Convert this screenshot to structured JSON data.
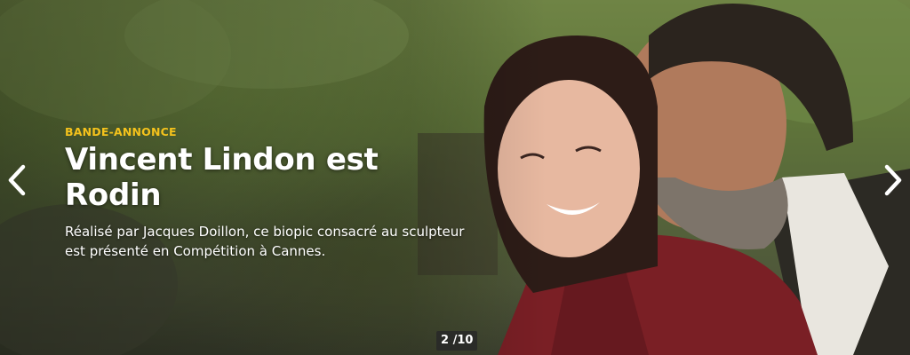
{
  "slide": {
    "kicker": "BANDE-ANNONCE",
    "title": "Vincent Lindon est Rodin",
    "description": "Réalisé par Jacques Doillon, ce biopic consacré au sculpteur est présenté en Compétition à Cannes."
  },
  "pager": {
    "label": "2 /10"
  },
  "icons": {
    "prev": "chevron-left-icon",
    "next": "chevron-right-icon"
  },
  "colors": {
    "kicker": "#f4c21c",
    "text": "#ffffff",
    "counter_bg": "#2a2a2a"
  }
}
